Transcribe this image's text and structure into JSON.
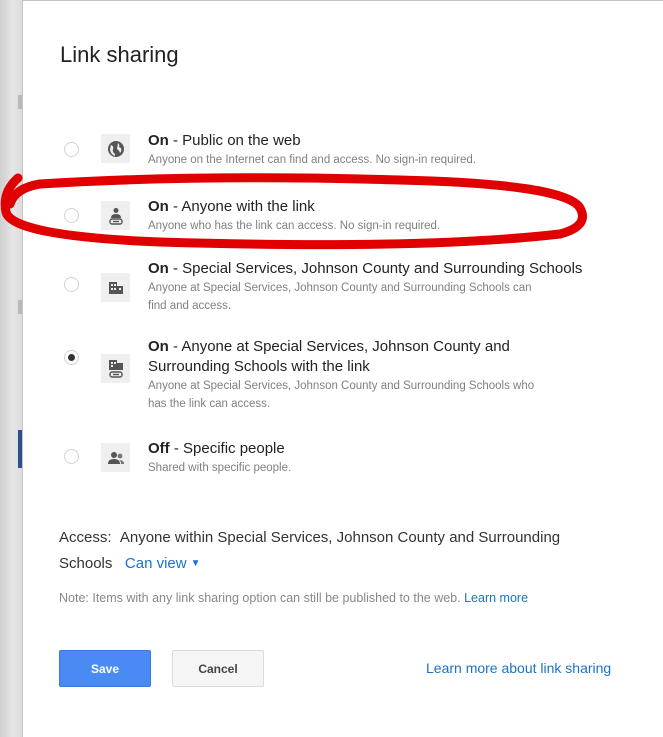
{
  "dialog": {
    "title": "Link sharing",
    "options": [
      {
        "status": "On",
        "label": " - Public on the web",
        "label2": "",
        "desc": "Anyone on the Internet can find and access. No sign-in required.",
        "desc2": "",
        "icon": "globe-icon",
        "selected": false
      },
      {
        "status": "On",
        "label": " - Anyone with the link",
        "label2": "",
        "desc": "Anyone who has the link can access. No sign-in required.",
        "desc2": "",
        "icon": "person-link-icon",
        "selected": false
      },
      {
        "status": "On",
        "label": " - Special Services, Johnson County and Surrounding Schools",
        "label2": "",
        "desc": "Anyone at Special Services, Johnson County and Surrounding Schools can",
        "desc2": "find and access.",
        "icon": "building-icon",
        "selected": false
      },
      {
        "status": "On",
        "label": " - Anyone at Special Services, Johnson County and",
        "label2": "Surrounding Schools with the link",
        "desc": "Anyone at Special Services, Johnson County and Surrounding Schools who",
        "desc2": "has the link can access.",
        "icon": "building-link-icon",
        "selected": true
      },
      {
        "status": "Off",
        "label": " - Specific people",
        "label2": "",
        "desc": "Shared with specific people.",
        "desc2": "",
        "icon": "people-icon",
        "selected": false
      }
    ],
    "access": {
      "label": "Access:",
      "line1": "Anyone within Special Services, Johnson County and Surrounding",
      "line2": "Schools",
      "permission": "Can view"
    },
    "note": {
      "text": "Note: Items with any link sharing option can still be published to the web.",
      "link": "Learn more"
    },
    "buttons": {
      "save": "Save",
      "cancel": "Cancel"
    },
    "learn_more_sharing": "Learn more about link sharing"
  },
  "colors": {
    "accent": "#4a8af4",
    "link": "#1a73c8",
    "annotation": "#e00000"
  }
}
